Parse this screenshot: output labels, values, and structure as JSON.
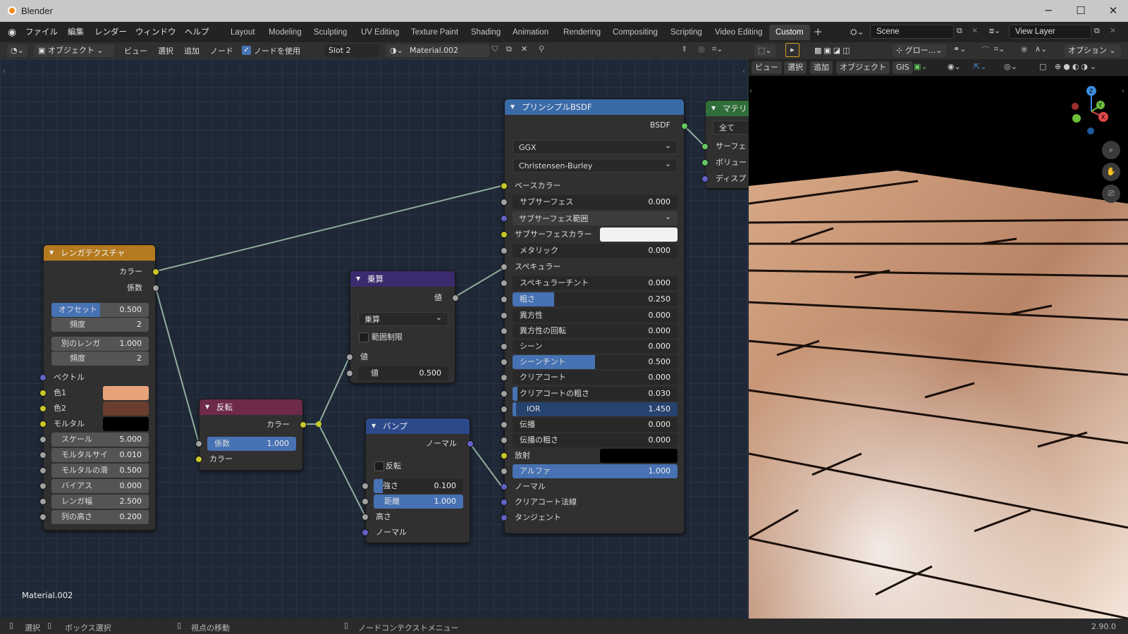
{
  "app": {
    "title": "Blender",
    "version": "2.90.0"
  },
  "menu": [
    "ファイル",
    "編集",
    "レンダー",
    "ウィンドウ",
    "ヘルプ"
  ],
  "workspaces": [
    "Layout",
    "Modeling",
    "Sculpting",
    "UV Editing",
    "Texture Paint",
    "Shading",
    "Animation",
    "Rendering",
    "Compositing",
    "Scripting",
    "Video Editing",
    "Custom"
  ],
  "scene": "Scene",
  "view_layer": "View Layer",
  "editor_header": {
    "mode": "オブジェクト",
    "menus": [
      "ビュー",
      "選択",
      "追加",
      "ノード"
    ],
    "use_nodes": "ノードを使用",
    "slot": "Slot 2",
    "material": "Material.002"
  },
  "viewport_header": {
    "transform": "グロー...",
    "options": "オプション",
    "menus": [
      "ビュー",
      "選択",
      "追加",
      "オブジェクト",
      "GIS"
    ]
  },
  "material_label": "Material.002",
  "nodes": {
    "brick": {
      "title": "レンガテクスチャ",
      "out_color": "カラー",
      "out_fac": "係数",
      "offset_label": "オフセット",
      "offset": "0.500",
      "freq1_label": "頻度",
      "freq1": "2",
      "squash_label": "別のレンガ",
      "squash": "1.000",
      "freq2_label": "頻度",
      "freq2": "2",
      "vector": "ベクトル",
      "color1": "色1",
      "color2": "色2",
      "mortar": "モルタル",
      "scale_label": "スケール",
      "scale": "5.000",
      "mortar_size_label": "モルタルサイ",
      "mortar_size": "0.010",
      "mortar_smooth_label": "モルタルの滑",
      "mortar_smooth": "0.500",
      "bias_label": "バイアス",
      "bias": "0.000",
      "brick_width_label": "レンガ幅",
      "brick_width": "2.500",
      "row_height_label": "列の高さ",
      "row_height": "0.200",
      "color1_hex": "#e8a27a",
      "color2_hex": "#6b3d2e",
      "mortar_hex": "#000000"
    },
    "invert": {
      "title": "反転",
      "out_color": "カラー",
      "fac_label": "係数",
      "fac": "1.000",
      "in_color": "カラー"
    },
    "multiply": {
      "title": "乗算",
      "out_value": "値",
      "operation": "乗算",
      "clamp": "範囲制限",
      "in_value": "値",
      "value_label": "値",
      "value": "0.500"
    },
    "bump": {
      "title": "バンプ",
      "out_normal": "ノーマル",
      "invert": "反転",
      "strength_label": "強さ",
      "strength": "0.100",
      "distance_label": "距離",
      "distance": "1.000",
      "height": "高さ",
      "normal": "ノーマル"
    },
    "bsdf": {
      "title": "プリンシプルBSDF",
      "out": "BSDF",
      "distribution": "GGX",
      "subsurface_method": "Christensen-Burley",
      "base_color": "ベースカラー",
      "subsurface_label": "サブサーフェス",
      "subsurface": "0.000",
      "subsurface_radius": "サブサーフェス範囲",
      "subsurface_color": "サブサーフェスカラー",
      "metallic_label": "メタリック",
      "metallic": "0.000",
      "specular": "スペキュラー",
      "specular_tint_label": "スペキュラーチント",
      "specular_tint": "0.000",
      "roughness_label": "粗さ",
      "roughness": "0.250",
      "anisotropic_label": "異方性",
      "anisotropic": "0.000",
      "aniso_rot_label": "異方性の回転",
      "aniso_rot": "0.000",
      "sheen_label": "シーン",
      "sheen": "0.000",
      "sheen_tint_label": "シーンチント",
      "sheen_tint": "0.500",
      "clearcoat_label": "クリアコート",
      "clearcoat": "0.000",
      "cc_rough_label": "クリアコートの粗さ",
      "cc_rough": "0.030",
      "ior_label": "IOR",
      "ior": "1.450",
      "transmission_label": "伝播",
      "transmission": "0.000",
      "trans_rough_label": "伝播の粗さ",
      "trans_rough": "0.000",
      "emission": "放射",
      "alpha_label": "アルファ",
      "alpha": "1.000",
      "normal": "ノーマル",
      "cc_normal": "クリアコート法線",
      "tangent": "タンジェント"
    },
    "output": {
      "title": "マテリ",
      "target": "全て",
      "surface": "サーフェ",
      "volume": "ボリュー",
      "displacement": "ディスプ"
    }
  },
  "status": {
    "select": "選択",
    "box_select": "ボックス選択",
    "move_view": "視点の移動",
    "context_menu": "ノードコンテクストメニュー"
  }
}
